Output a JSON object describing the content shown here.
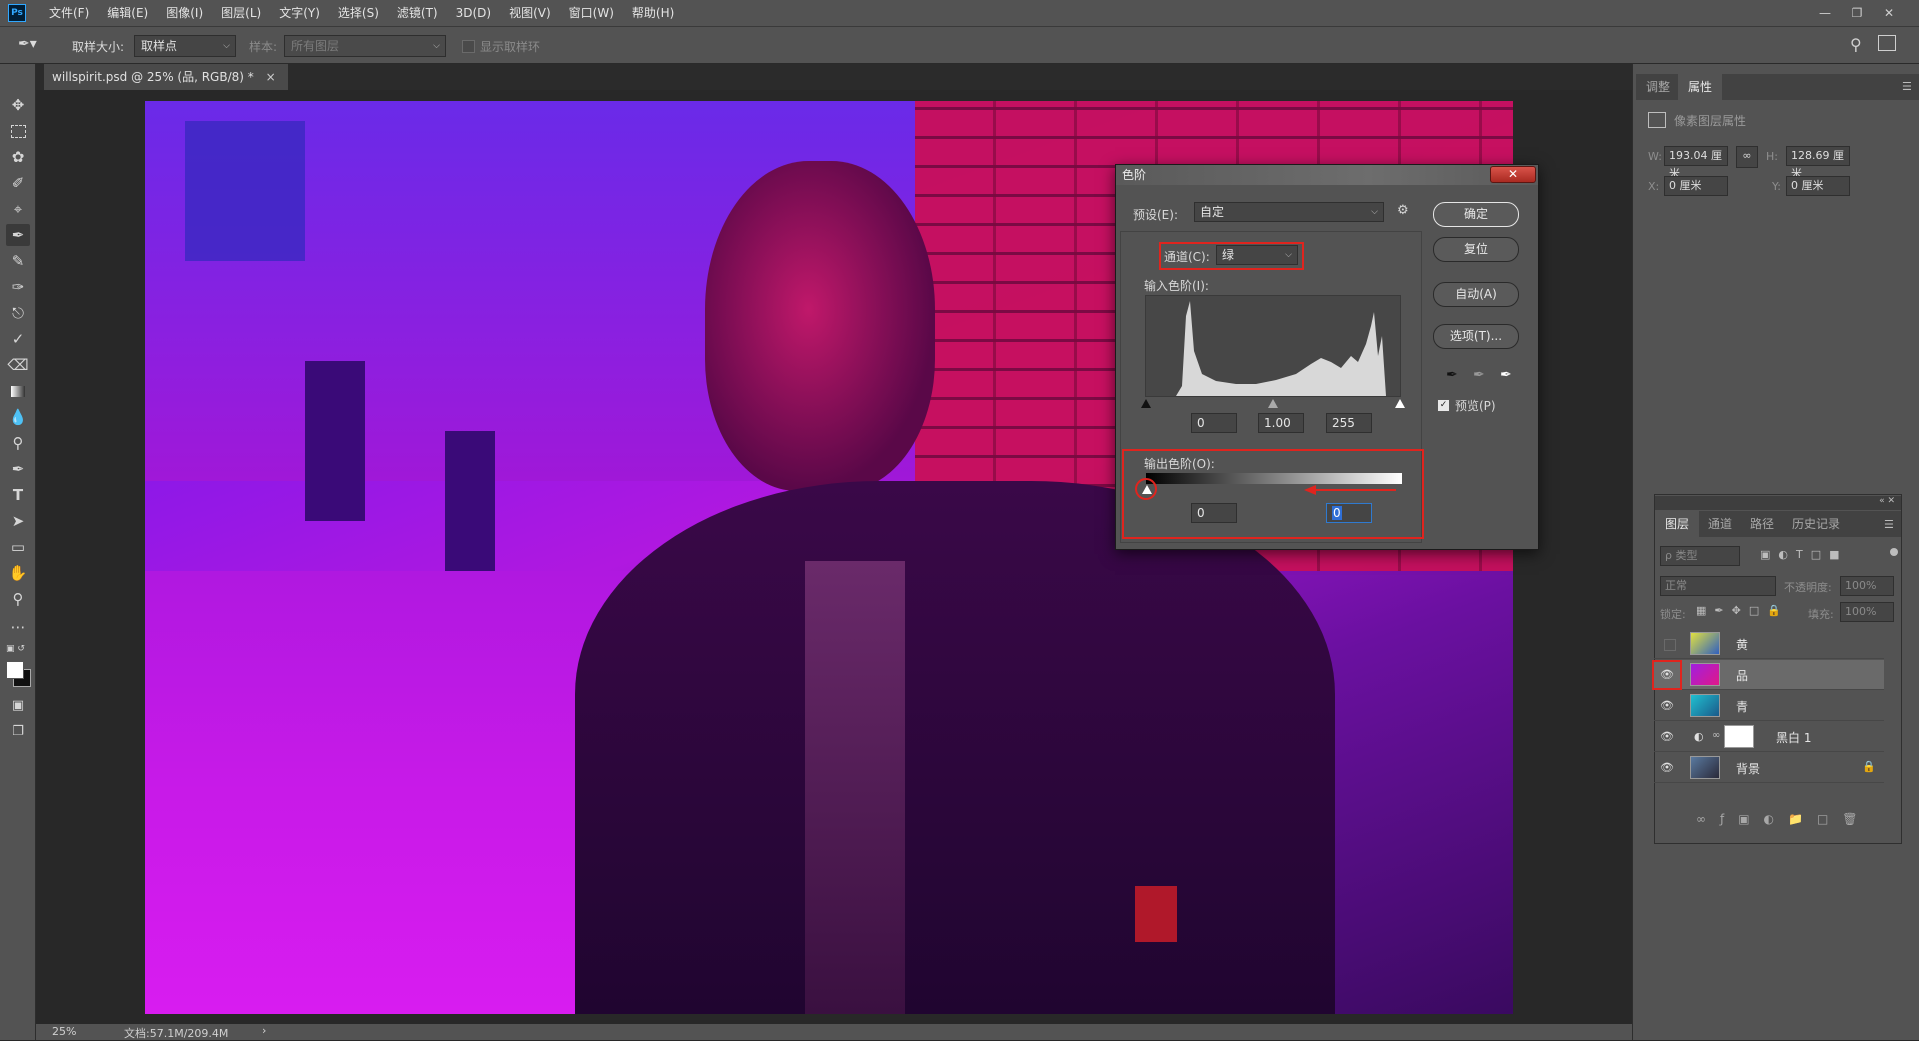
{
  "app": {
    "logo": "Ps"
  },
  "menu": [
    "文件(F)",
    "编辑(E)",
    "图像(I)",
    "图层(L)",
    "文字(Y)",
    "选择(S)",
    "滤镜(T)",
    "3D(D)",
    "视图(V)",
    "窗口(W)",
    "帮助(H)"
  ],
  "options": {
    "sample_size_label": "取样大小:",
    "sample_size_value": "取样点",
    "sample_label": "样本:",
    "sample_value": "所有图层",
    "show_ring_label": "显示取样环"
  },
  "document_tab": {
    "title": "willspirit.psd @ 25% (品, RGB/8) *",
    "close": "×"
  },
  "status": {
    "zoom": "25%",
    "doc_info": "文档:57.1M/209.4M",
    "arrow": "›"
  },
  "properties_panel": {
    "tabs": [
      "调整",
      "属性"
    ],
    "title": "像素图层属性",
    "w_label": "W:",
    "w_value": "193.04 厘米",
    "h_label": "H:",
    "h_value": "128.69 厘米",
    "x_label": "X:",
    "x_value": "0 厘米",
    "y_label": "Y:",
    "y_value": "0 厘米"
  },
  "layers_panel": {
    "tabs": [
      "图层",
      "通道",
      "路径",
      "历史记录"
    ],
    "filter_placeholder": "ρ 类型",
    "blend_mode": "正常",
    "opacity_label": "不透明度:",
    "opacity_value": "100%",
    "lock_label": "锁定:",
    "fill_label": "填充:",
    "fill_value": "100%",
    "layers": [
      {
        "name": "黄",
        "visible": false,
        "selected": false
      },
      {
        "name": "品",
        "visible": true,
        "selected": true
      },
      {
        "name": "青",
        "visible": true,
        "selected": false
      },
      {
        "name": "黑白 1",
        "visible": true,
        "selected": false
      },
      {
        "name": "背景",
        "visible": true,
        "selected": false
      }
    ]
  },
  "levels_dialog": {
    "title": "色阶",
    "preset_label": "预设(E):",
    "preset_value": "自定",
    "channel_label": "通道(C):",
    "channel_value": "绿",
    "input_label": "输入色阶(I):",
    "input_black": "0",
    "input_gamma": "1.00",
    "input_white": "255",
    "output_label": "输出色阶(O):",
    "output_black": "0",
    "output_white": "0",
    "buttons": {
      "ok": "确定",
      "reset": "复位",
      "auto": "自动(A)",
      "options": "选项(T)..."
    },
    "preview_label": "预览(P)",
    "preview_checked": true,
    "close": "✕"
  },
  "colors": {
    "highlight": "#e0241e",
    "accent_blue": "#31a8ff"
  }
}
